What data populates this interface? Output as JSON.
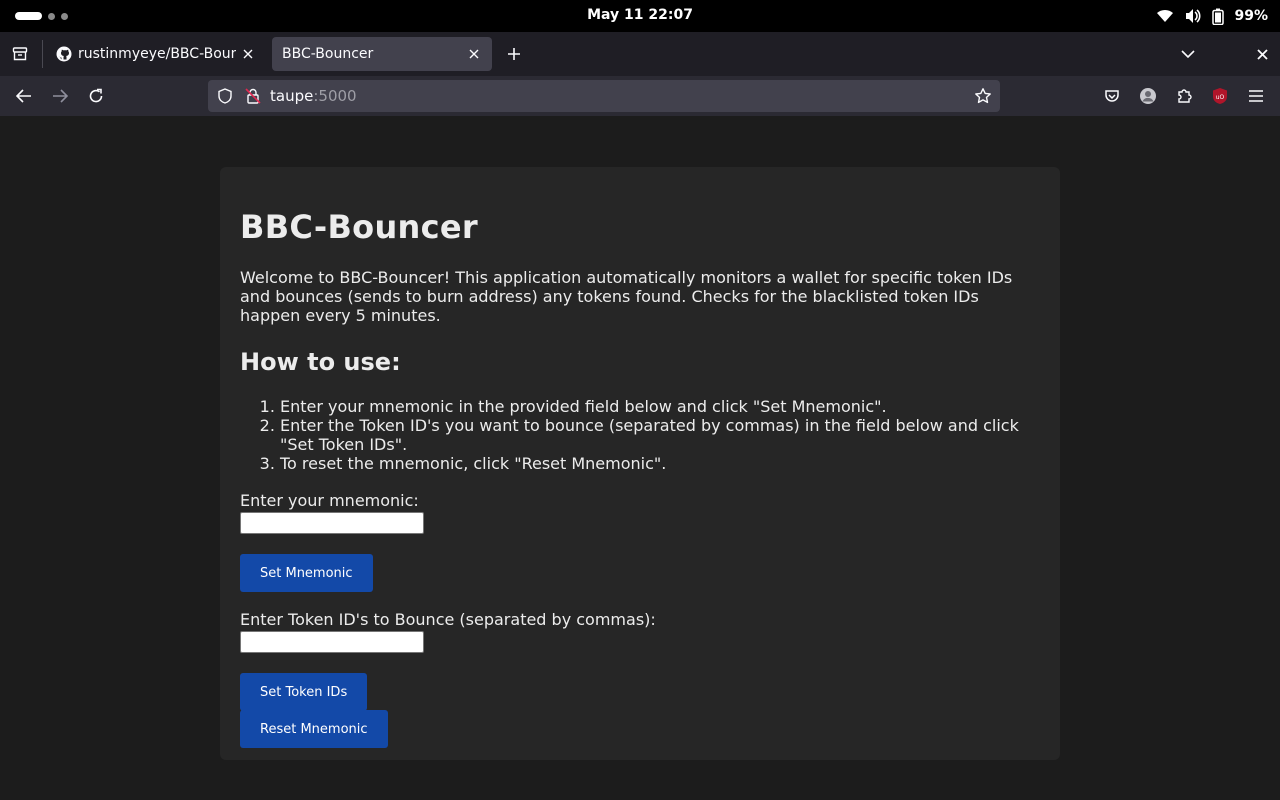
{
  "system": {
    "clock": "May 11  22:07",
    "battery": "99%"
  },
  "browser": {
    "tabs": [
      {
        "title": "rustinmyeye/BBC-Bouncer",
        "active": false
      },
      {
        "title": "BBC-Bouncer",
        "active": true
      }
    ],
    "url_host": "taupe",
    "url_port": ":5000"
  },
  "page": {
    "title": "BBC-Bouncer",
    "intro": "Welcome to BBC-Bouncer! This application automatically monitors a wallet for specific token IDs and bounces (sends to burn address) any tokens found. Checks for the blacklisted token IDs happen every 5 minutes.",
    "howto_heading": "How to use:",
    "steps": [
      "Enter your mnemonic in the provided field below and click \"Set Mnemonic\".",
      "Enter the Token ID's you want to bounce (separated by commas) in the field below and click \"Set Token IDs\".",
      "To reset the mnemonic, click \"Reset Mnemonic\"."
    ],
    "mnemonic_label": "Enter your mnemonic:",
    "mnemonic_value": "",
    "set_mnemonic_button": "Set Mnemonic",
    "token_label": "Enter Token ID's to Bounce (separated by commas):",
    "token_value": "",
    "set_token_button": "Set Token IDs",
    "reset_button": "Reset Mnemonic"
  }
}
